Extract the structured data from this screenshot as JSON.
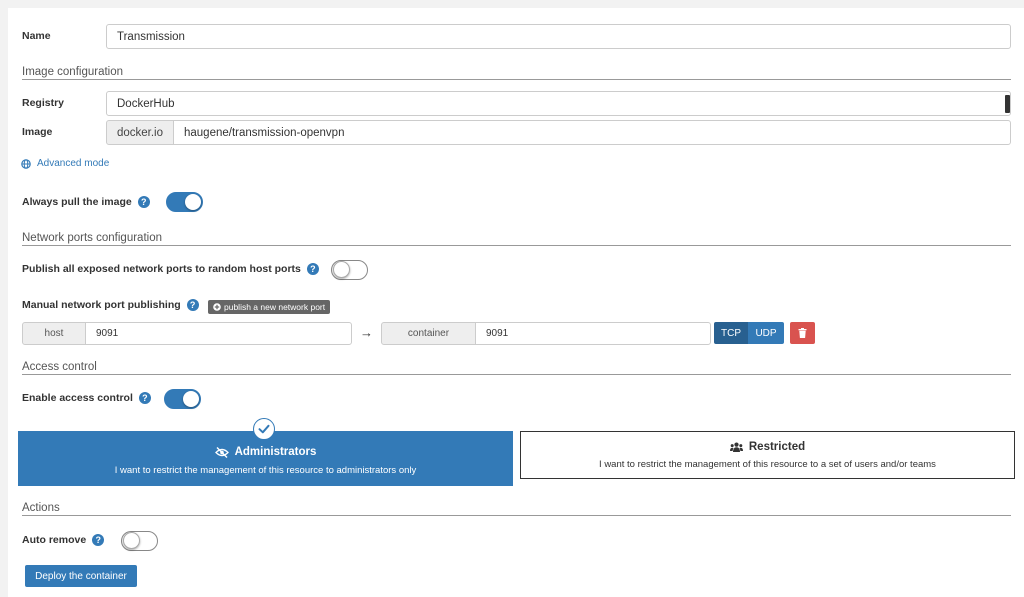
{
  "name": {
    "label": "Name",
    "value": "Transmission"
  },
  "image_config": {
    "title": "Image configuration",
    "registry_label": "Registry",
    "registry_value": "DockerHub",
    "image_label": "Image",
    "image_prefix": "docker.io",
    "image_value": "haugene/transmission-openvpn",
    "advanced_mode": "Advanced mode"
  },
  "always_pull": {
    "label": "Always pull the image",
    "enabled": true
  },
  "network": {
    "title": "Network ports configuration",
    "publish_all_label": "Publish all exposed network ports to random host ports",
    "publish_all_enabled": false,
    "manual_label": "Manual network port publishing",
    "add_port_label": "publish a new network port",
    "host_addon": "host",
    "host_value": "9091",
    "arrow": "→",
    "container_addon": "container",
    "container_value": "9091",
    "tcp_label": "TCP",
    "udp_label": "UDP"
  },
  "access": {
    "title": "Access control",
    "enable_label": "Enable access control",
    "enabled": true,
    "admin_title": "Administrators",
    "admin_desc": "I want to restrict the management of this resource to administrators only",
    "restricted_title": "Restricted",
    "restricted_desc": "I want to restrict the management of this resource to a set of users and/or teams"
  },
  "actions": {
    "title": "Actions",
    "auto_remove_label": "Auto remove",
    "auto_remove_enabled": false,
    "deploy_label": "Deploy the container"
  },
  "help_glyph": "?",
  "colors": {
    "primary": "#337ab7",
    "dark_primary": "#286090",
    "danger": "#d9534f"
  }
}
